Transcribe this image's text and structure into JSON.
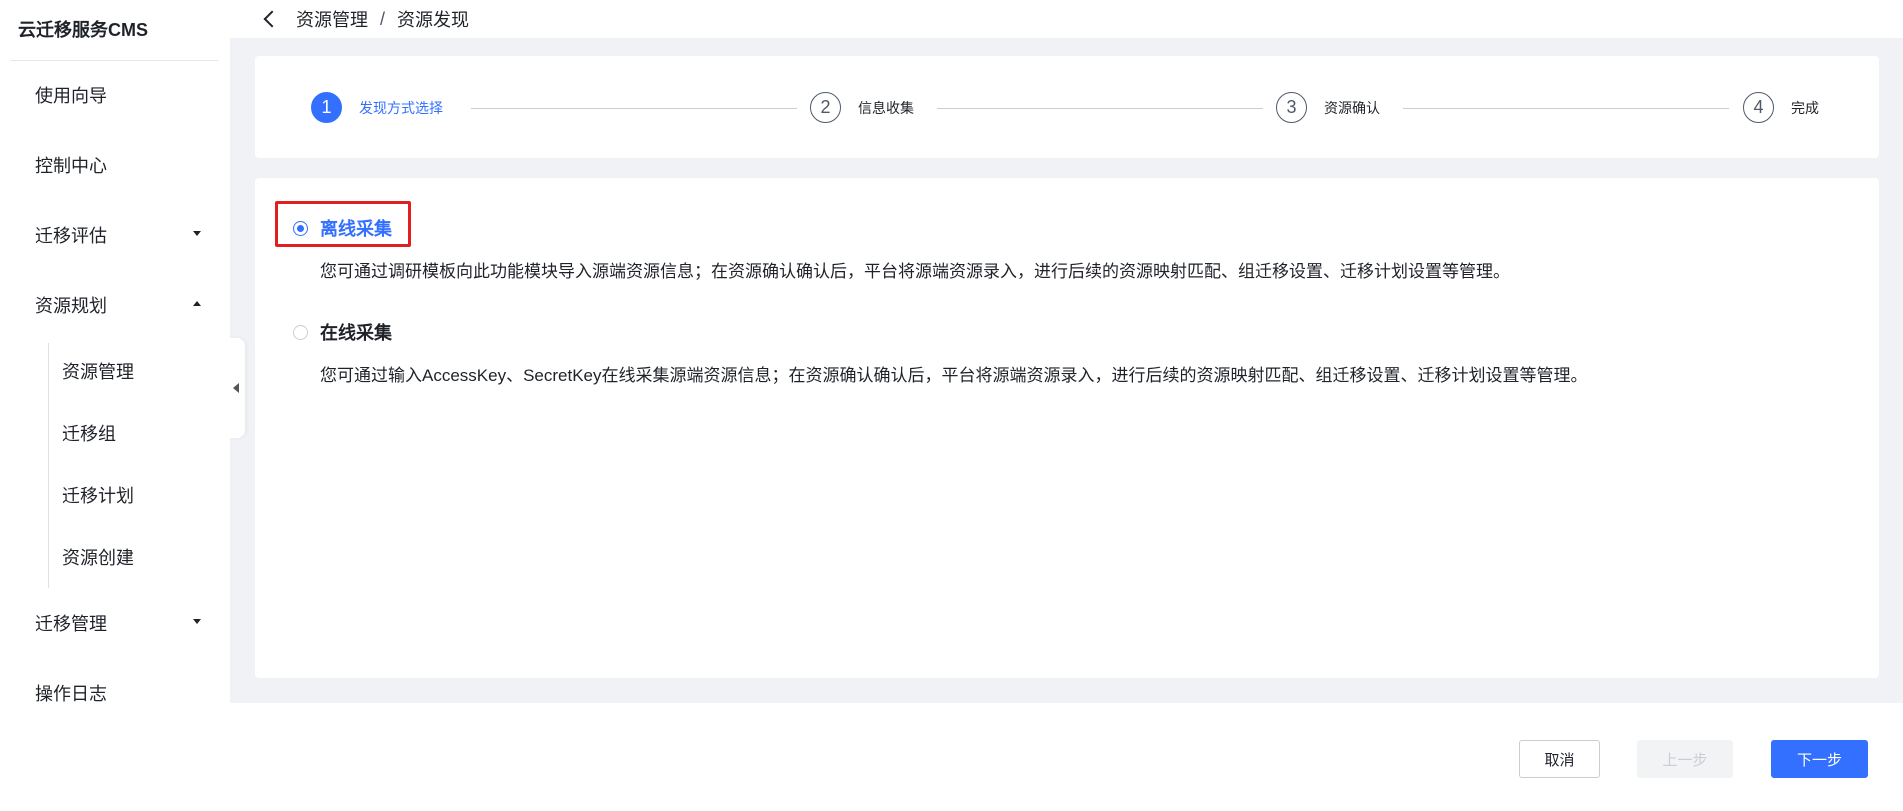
{
  "app": {
    "title": "云迁移服务CMS"
  },
  "sidebar": {
    "items": [
      {
        "label": "使用向导"
      },
      {
        "label": "控制中心"
      },
      {
        "label": "迁移评估"
      },
      {
        "label": "资源规划"
      },
      {
        "label": "迁移管理"
      },
      {
        "label": "操作日志"
      }
    ],
    "sub_items": [
      {
        "label": "资源管理"
      },
      {
        "label": "迁移组"
      },
      {
        "label": "迁移计划"
      },
      {
        "label": "资源创建"
      }
    ]
  },
  "breadcrumb": {
    "parent": "资源管理",
    "separator": "/",
    "current": "资源发现"
  },
  "steps": [
    {
      "number": "1",
      "label": "发现方式选择",
      "active": true
    },
    {
      "number": "2",
      "label": "信息收集",
      "active": false
    },
    {
      "number": "3",
      "label": "资源确认",
      "active": false
    },
    {
      "number": "4",
      "label": "完成",
      "active": false
    }
  ],
  "options": [
    {
      "label": "离线采集",
      "checked": true,
      "description": "您可通过调研模板向此功能模块导入源端资源信息；在资源确认确认后，平台将源端资源录入，进行后续的资源映射匹配、组迁移设置、迁移计划设置等管理。"
    },
    {
      "label": "在线采集",
      "checked": false,
      "description": "您可通过输入AccessKey、SecretKey在线采集源端资源信息；在资源确认确认后，平台将源端资源录入，进行后续的资源映射匹配、组迁移设置、迁移计划设置等管理。"
    }
  ],
  "footer": {
    "cancel_label": "取消",
    "prev_label": "上一步",
    "next_label": "下一步"
  },
  "colors": {
    "accent": "#3370ff",
    "highlight": "#e02020"
  },
  "icons": {
    "back": "chevron-left-icon",
    "collapse": "caret-left-icon",
    "expand": "caret-down-icon",
    "collapse_menu": "caret-up-icon"
  }
}
